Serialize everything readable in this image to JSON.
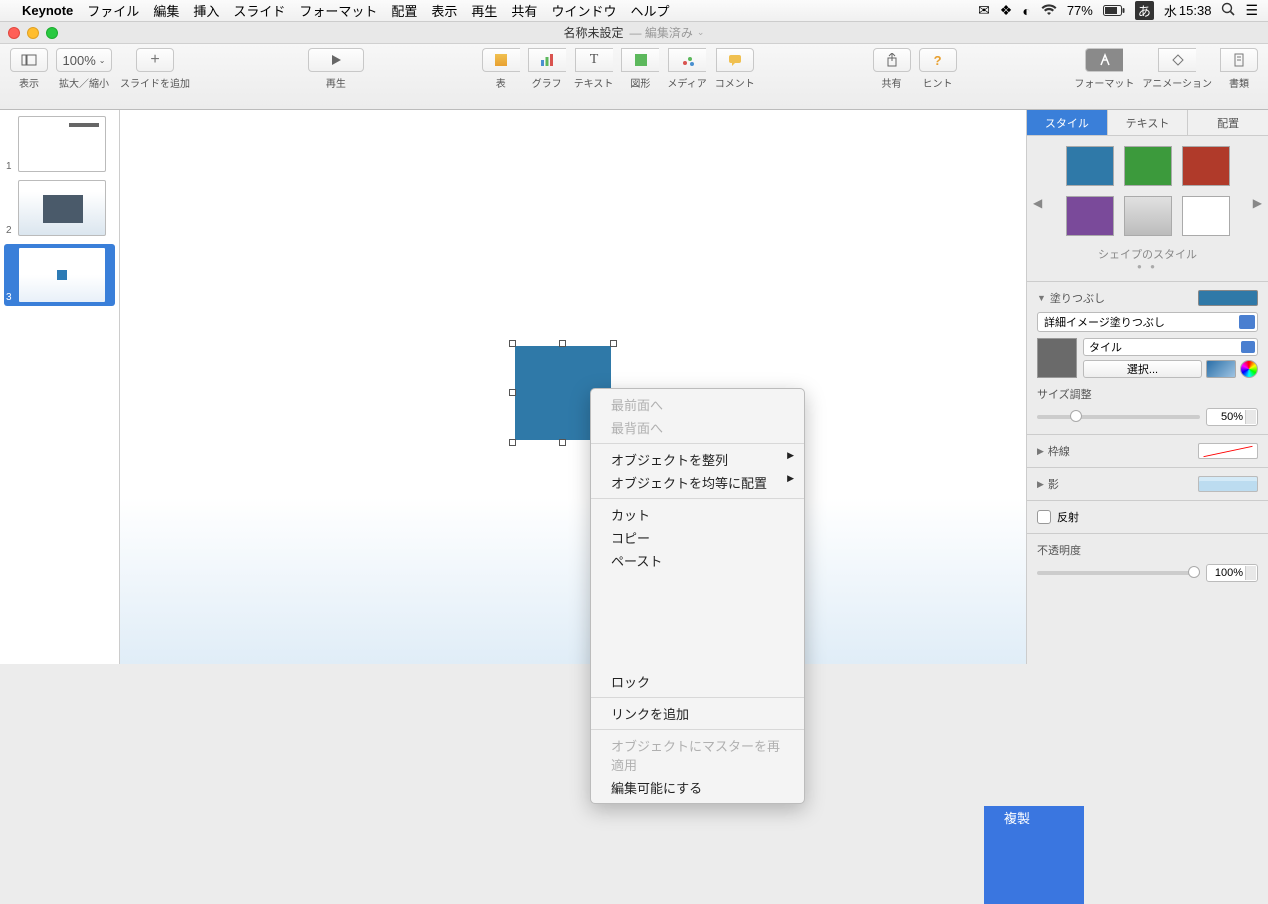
{
  "menubar": {
    "app": "Keynote",
    "items": [
      "ファイル",
      "編集",
      "挿入",
      "スライド",
      "フォーマット",
      "配置",
      "表示",
      "再生",
      "共有",
      "ウインドウ",
      "ヘルプ"
    ],
    "battery": "77%",
    "ime": "あ",
    "day": "水",
    "time": "15:38"
  },
  "titlebar": {
    "title": "名称未設定",
    "subtitle": "編集済み"
  },
  "toolbar": {
    "view": "表示",
    "zoom_value": "100%",
    "zoom": "拡大／縮小",
    "add_slide": "スライドを追加",
    "play": "再生",
    "table": "表",
    "chart": "グラフ",
    "text": "テキスト",
    "shape": "図形",
    "media": "メディア",
    "comment": "コメント",
    "share": "共有",
    "hint": "ヒント",
    "format": "フォーマット",
    "animation": "アニメーション",
    "document": "書類"
  },
  "slides": {
    "nums": [
      "1",
      "2",
      "3"
    ]
  },
  "context_menu": {
    "front": "最前面へ",
    "back": "最背面へ",
    "align": "オブジェクトを整列",
    "distribute": "オブジェクトを均等に配置",
    "cut": "カット",
    "copy": "コピー",
    "paste": "ペースト",
    "duplicate": "複製",
    "lock": "ロック",
    "add_link": "リンクを追加",
    "reapply_master": "オブジェクトにマスターを再適用",
    "make_editable": "編集可能にする"
  },
  "inspector": {
    "tabs": {
      "style": "スタイル",
      "text": "テキスト",
      "arrange": "配置"
    },
    "shape_styles_label": "シェイプのスタイル",
    "swatches": [
      "#2f79a8",
      "#3c9a3c",
      "#b03a2a",
      "#7a4a9a",
      "#c8c8c8",
      "#ffffff"
    ],
    "fill": {
      "label": "塗りつぶし",
      "type": "詳細イメージ塗りつぶし",
      "tile": "タイル",
      "choose": "選択...",
      "size_label": "サイズ調整",
      "size_value": "50%"
    },
    "border": {
      "label": "枠線"
    },
    "shadow": {
      "label": "影"
    },
    "reflection": {
      "label": "反射"
    },
    "opacity": {
      "label": "不透明度",
      "value": "100%"
    }
  }
}
